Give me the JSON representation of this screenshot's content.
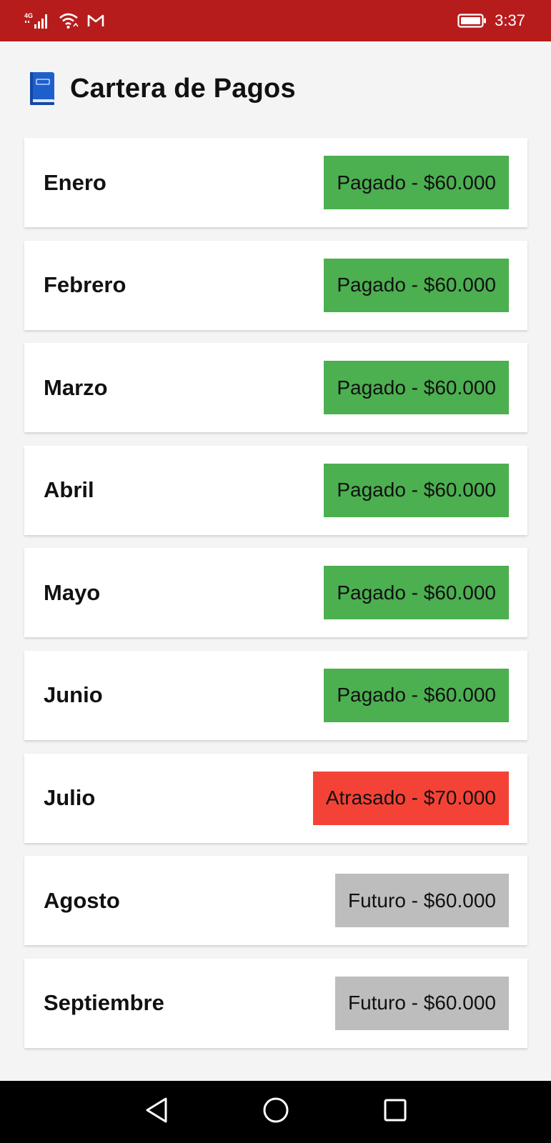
{
  "status_bar": {
    "network_label": "4G",
    "time": "3:37"
  },
  "header": {
    "icon": "book-icon",
    "title": "Cartera de Pagos"
  },
  "colors": {
    "pagado": "#4caf50",
    "atrasado": "#f44336",
    "futuro": "#bdbdbd",
    "status_bar": "#b71c1c"
  },
  "payments": [
    {
      "month": "Enero",
      "status": "pagado",
      "badge": "Pagado - $60.000"
    },
    {
      "month": "Febrero",
      "status": "pagado",
      "badge": "Pagado - $60.000"
    },
    {
      "month": "Marzo",
      "status": "pagado",
      "badge": "Pagado - $60.000"
    },
    {
      "month": "Abril",
      "status": "pagado",
      "badge": "Pagado - $60.000"
    },
    {
      "month": "Mayo",
      "status": "pagado",
      "badge": "Pagado - $60.000"
    },
    {
      "month": "Junio",
      "status": "pagado",
      "badge": "Pagado - $60.000"
    },
    {
      "month": "Julio",
      "status": "atrasado",
      "badge": "Atrasado - $70.000"
    },
    {
      "month": "Agosto",
      "status": "futuro",
      "badge": "Futuro - $60.000"
    },
    {
      "month": "Septiembre",
      "status": "futuro",
      "badge": "Futuro - $60.000"
    }
  ],
  "nav": {
    "back_icon": "back-triangle-icon",
    "home_icon": "home-circle-icon",
    "recents_icon": "recents-square-icon"
  }
}
